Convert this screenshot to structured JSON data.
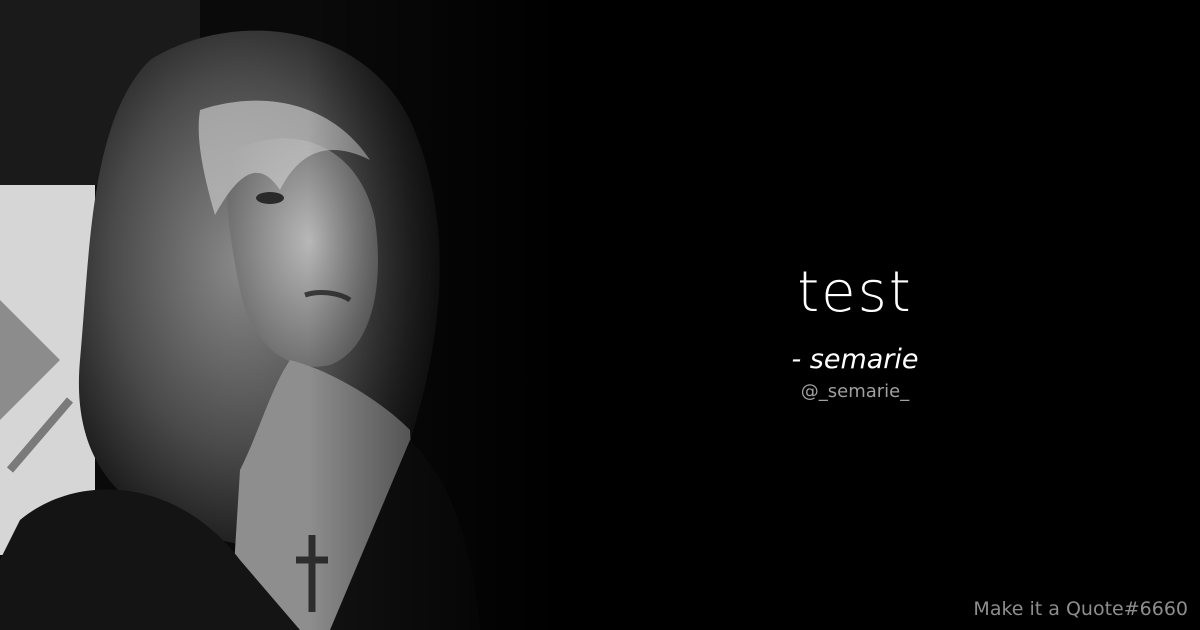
{
  "background_color": "#000000",
  "photo": {
    "subject": "black-and-white portrait of a woman with long wavy hair and a cross pendant"
  },
  "quote": {
    "text": "test"
  },
  "author": {
    "name": "- semarie",
    "handle": "@_semarie_"
  },
  "watermark": {
    "text": "Make it a Quote#6660"
  }
}
